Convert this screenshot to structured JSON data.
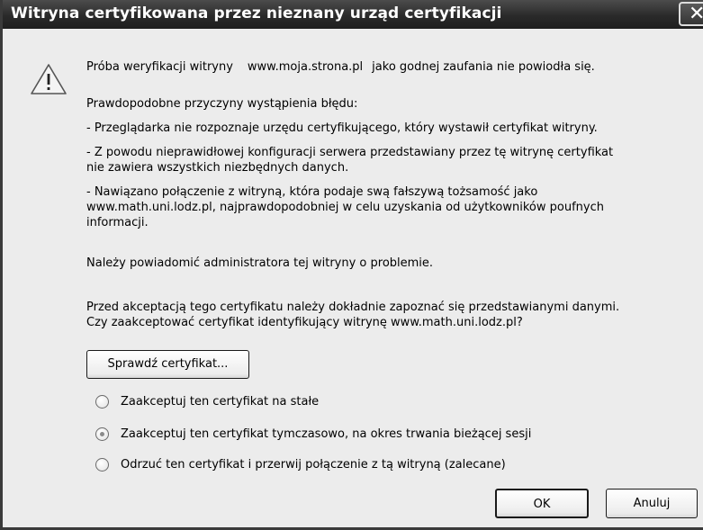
{
  "dialog": {
    "title": "Witryna certyfikowana przez nieznany urząd certyfikacji",
    "close_symbol": "✕"
  },
  "icons": {
    "warning": "warning-triangle-icon",
    "close": "close-icon"
  },
  "content": {
    "line_verify_prefix": "Próba weryfikacji witryny",
    "verify_site": "www.moja.strona.pl",
    "line_verify_suffix": "jako godnej zaufania nie powiodła się.",
    "causes_heading": "Prawdopodobne przyczyny wystąpienia błędu:",
    "cause1": "- Przeglądarka nie rozpoznaje urzędu certyfikującego, który wystawił certyfikat witryny.",
    "cause2_line1": "- Z powodu nieprawidłowej konfiguracji serwera przedstawiany przez tę witrynę certyfikat",
    "cause2_line2": "nie zawiera wszystkich niezbędnych danych.",
    "cause3_line1": "- Nawiązano połączenie z witryną, która podaje swą fałszywą tożsamość jako",
    "cause3_line2": "www.math.uni.lodz.pl, najprawdopodobniej w celu uzyskania od użytkowników poufnych",
    "cause3_line3": "informacji.",
    "notify": "Należy powiadomić administratora tej witryny o problemie.",
    "before_line1": "Przed akceptacją tego certyfikatu należy dokładnie zapoznać się przedstawianymi danymi.",
    "before_line2": "Czy zaakceptować certyfikat identyfikujący witrynę www.math.uni.lodz.pl?"
  },
  "buttons": {
    "check_certificate": "Sprawdź certyfikat...",
    "ok": "OK",
    "cancel": "Anuluj"
  },
  "options": [
    {
      "label": "Zaakceptuj ten certyfikat na stałe",
      "selected": false
    },
    {
      "label": "Zaakceptuj ten certyfikat tymczasowo, na okres trwania bieżącej sesji",
      "selected": true
    },
    {
      "label": "Odrzuć ten certyfikat i przerwij połączenie z tą witryną (zalecane)",
      "selected": false
    }
  ]
}
